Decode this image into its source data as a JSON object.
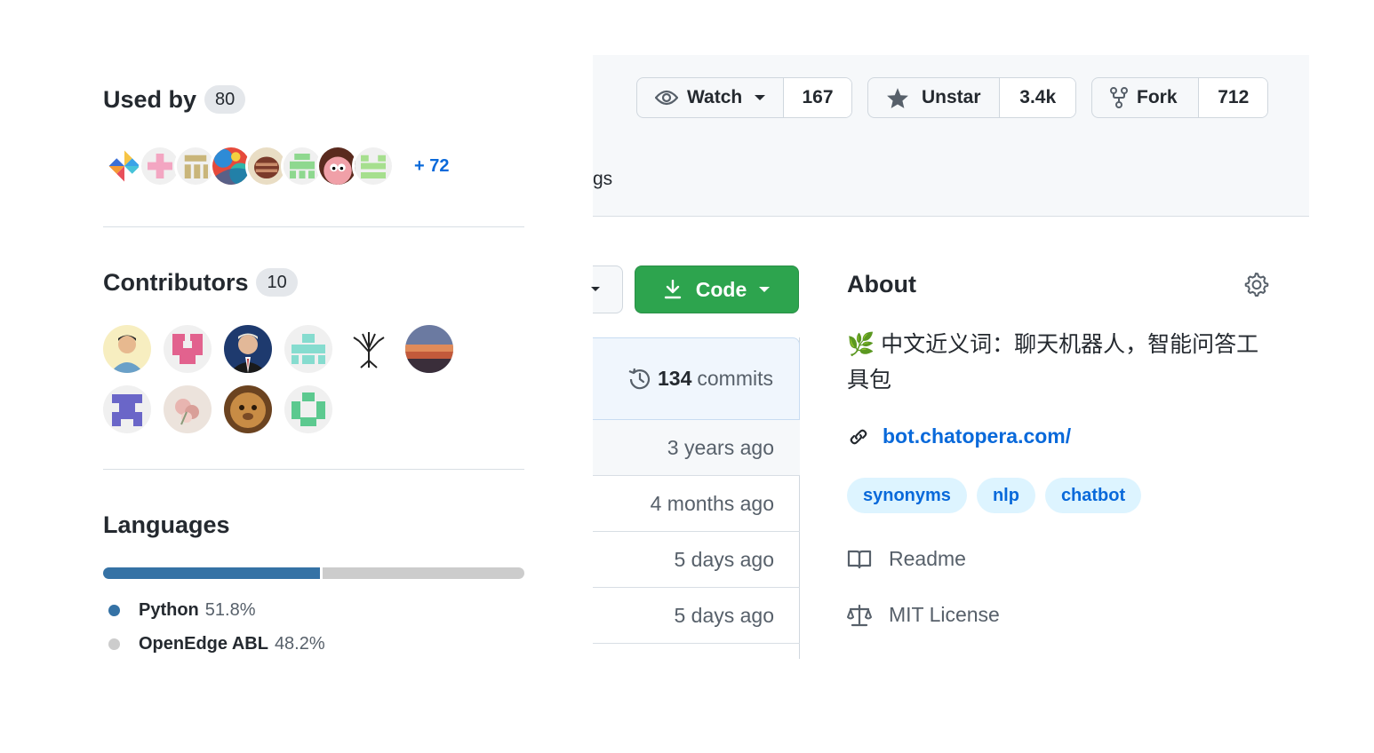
{
  "used_by": {
    "title": "Used by",
    "count": "80",
    "more": "+ 72",
    "avatars": [
      "used-avatar-pinwheel",
      "used-avatar-pink-cross",
      "used-avatar-olive-blocks",
      "used-avatar-colorful",
      "used-avatar-sketch",
      "used-avatar-green-identicon",
      "used-avatar-patrick-star",
      "used-avatar-green-bars"
    ]
  },
  "contributors": {
    "title": "Contributors",
    "count": "10",
    "avatars": [
      "contributor-photo-man",
      "contributor-pink-identicon",
      "contributor-photo-suit",
      "contributor-teal-identicon",
      "contributor-tree",
      "contributor-sunset",
      "contributor-purple-identicon",
      "contributor-flowers",
      "contributor-lion",
      "contributor-green-identicon"
    ]
  },
  "languages": {
    "title": "Languages",
    "items": [
      {
        "name": "Python",
        "percent": "51.8%",
        "fraction": 0.518,
        "color": "#3572a5"
      },
      {
        "name": "OpenEdge ABL",
        "percent": "48.2%",
        "fraction": 0.482,
        "color": "#cccccc"
      }
    ]
  },
  "header": {
    "watch": {
      "label": "Watch",
      "count": "167"
    },
    "star": {
      "label": "Unstar",
      "count": "3.4k"
    },
    "fork": {
      "label": "Fork",
      "count": "712"
    },
    "tab_fragment": "gs"
  },
  "code_button": {
    "label": "Code"
  },
  "files": {
    "commits_count": "134",
    "commits_label": "commits",
    "rows": [
      "3 years ago",
      "4 months ago",
      "5 days ago",
      "5 days ago"
    ]
  },
  "about": {
    "title": "About",
    "description": "🌿 中文近义词：聊天机器人，智能问答工具包",
    "website": "bot.chatopera.com/",
    "topics": [
      "synonyms",
      "nlp",
      "chatbot"
    ],
    "readme": "Readme",
    "license": "MIT License"
  },
  "colors": {
    "accent": "#0969da",
    "green": "#2da44e",
    "python": "#3572a5",
    "openedge": "#cccccc"
  }
}
